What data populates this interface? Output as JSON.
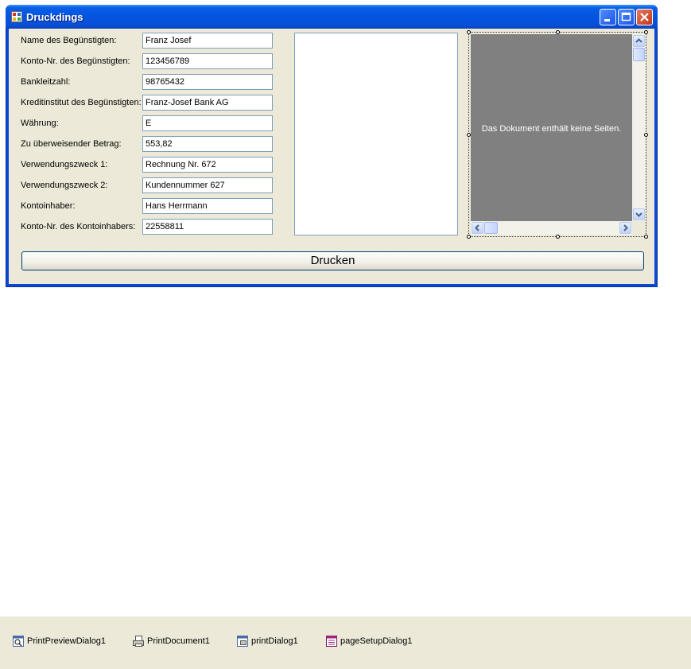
{
  "window": {
    "title": "Druckdings",
    "controls": [
      "minimize-icon",
      "maximize-icon",
      "close-icon"
    ]
  },
  "form": {
    "rows": [
      {
        "label": "Name des Begünstigten:",
        "value": "Franz Josef"
      },
      {
        "label": "Konto-Nr. des Begünstigten:",
        "value": "123456789"
      },
      {
        "label": "Bankleitzahl:",
        "value": "98765432"
      },
      {
        "label": "Kreditinstitut des Begünstigten:",
        "value": "Franz-Josef Bank AG"
      },
      {
        "label": "Währung:",
        "value": "E"
      },
      {
        "label": "Zu überweisender Betrag:",
        "value": "553,82"
      },
      {
        "label": "Verwendungszweck 1:",
        "value": "Rechnung Nr. 672"
      },
      {
        "label": "Verwendungszweck 2:",
        "value": "Kundennummer 627"
      },
      {
        "label": "Kontoinhaber:",
        "value": "Hans Herrmann"
      },
      {
        "label": "Konto-Nr. des Kontoinhabers:",
        "value": "22558811"
      }
    ]
  },
  "preview": {
    "message": "Das Dokument enthält keine Seiten."
  },
  "print_button": {
    "label": "Drucken"
  },
  "tray": {
    "items": [
      {
        "label": "PrintPreviewDialog1",
        "icon": "print-preview-icon"
      },
      {
        "label": "PrintDocument1",
        "icon": "print-document-icon"
      },
      {
        "label": "printDialog1",
        "icon": "print-dialog-icon"
      },
      {
        "label": "pageSetupDialog1",
        "icon": "page-setup-icon"
      }
    ]
  },
  "colors": {
    "titlebar": "#0454e0",
    "client": "#ece9d8",
    "preview_bg": "#808080",
    "field_border": "#7f9db9"
  }
}
